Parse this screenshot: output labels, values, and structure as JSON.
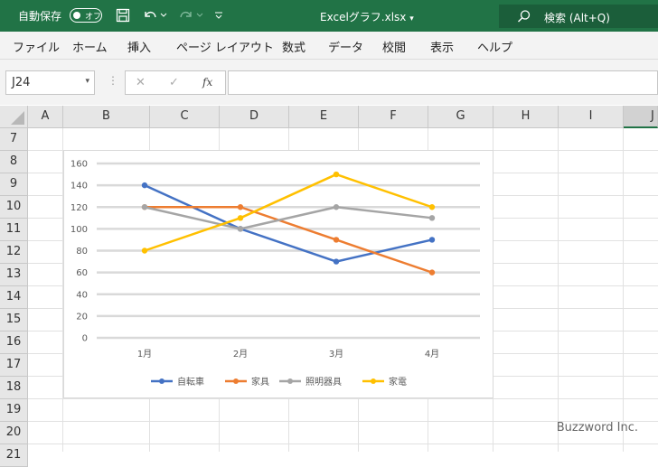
{
  "titlebar": {
    "autosave_label": "自動保存",
    "toggle_state": "オフ",
    "filename": "Excelグラフ.xlsx",
    "filename_caret": "▾",
    "search_label": "検索 (Alt+Q)"
  },
  "menu": [
    "ファイル",
    "ホーム",
    "挿入",
    "ページ レイアウト",
    "数式",
    "データ",
    "校閲",
    "表示",
    "ヘルプ"
  ],
  "formula_bar": {
    "name_box": "J24",
    "name_box_arrow": "▾",
    "cancel_glyph": "✕",
    "enter_glyph": "✓",
    "fx_glyph": "fx",
    "formula": ""
  },
  "columns": [
    "A",
    "B",
    "C",
    "D",
    "E",
    "F",
    "G",
    "H",
    "I",
    "J"
  ],
  "rows": [
    "7",
    "8",
    "9",
    "10",
    "11",
    "12",
    "13",
    "14",
    "15",
    "16",
    "17",
    "18",
    "19",
    "20",
    "21"
  ],
  "chart_data": {
    "type": "line",
    "categories": [
      "1月",
      "2月",
      "3月",
      "4月"
    ],
    "series": [
      {
        "name": "自転車",
        "values": [
          140,
          100,
          70,
          90
        ],
        "color": "#4472C4"
      },
      {
        "name": "家具",
        "values": [
          120,
          120,
          90,
          60
        ],
        "color": "#ED7D31"
      },
      {
        "name": "照明器具",
        "values": [
          120,
          100,
          120,
          110
        ],
        "color": "#A5A5A5"
      },
      {
        "name": "家電",
        "values": [
          80,
          110,
          150,
          120
        ],
        "color": "#FFC000"
      }
    ],
    "ylim": [
      0,
      160
    ],
    "yticks": [
      "0",
      "20",
      "40",
      "60",
      "80",
      "100",
      "120",
      "140",
      "160"
    ],
    "grid": true,
    "legend": "bottom",
    "title": "",
    "xlabel": "",
    "ylabel": ""
  },
  "watermark": "Buzzword Inc."
}
